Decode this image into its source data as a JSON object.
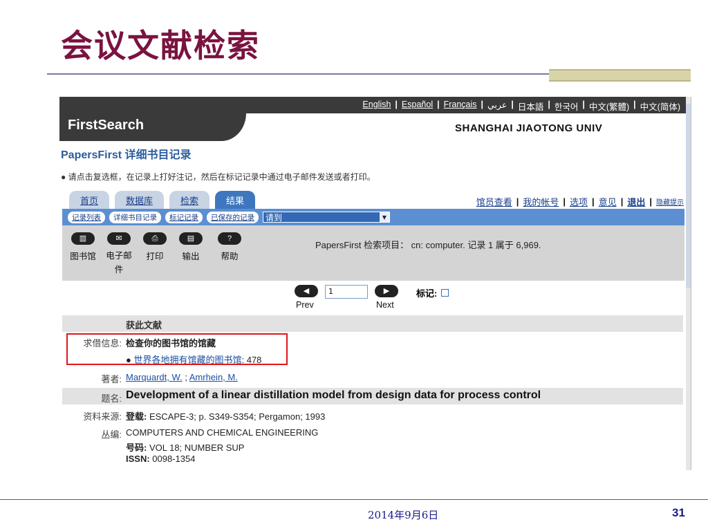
{
  "slide": {
    "title": "会议文献检索",
    "date": "2014年9月6日",
    "page": "31"
  },
  "lang_links": [
    "English",
    "Español",
    "Français",
    "عربي",
    "日本語",
    "한국어",
    "中文(繁體)",
    "中文(简体)"
  ],
  "header": {
    "logo": "FirstSearch",
    "institution": "SHANGHAI JIAOTONG UNIV"
  },
  "record_title": "PapersFirst 详细书目记录",
  "hint": "● 请点击复选框，在记录上打好注记，然后在标记记录中通过电子邮件发送或者打印。",
  "tabs": [
    "首页",
    "数据库",
    "检索",
    "结果"
  ],
  "account_links": {
    "view": "馆员查看",
    "account": "我的帐号",
    "options": "选项",
    "comment": "意见",
    "exit": "退出",
    "hide": "隐藏提示"
  },
  "subnav": {
    "list": "记录列表",
    "detail": "详细书目记录",
    "marked": "标记记录",
    "saved": "已保存的记录",
    "goto": "请到"
  },
  "tools": [
    {
      "label": "图书馆",
      "icon": "library-icon"
    },
    {
      "label": "电子邮件",
      "icon": "email-icon"
    },
    {
      "label": "打印",
      "icon": "print-icon"
    },
    {
      "label": "输出",
      "icon": "export-icon"
    },
    {
      "label": "帮助",
      "icon": "help-icon"
    }
  ],
  "search_info": "PapersFirst 检索项目： cn: computer. 记录 1 属于 6,969.",
  "pager": {
    "page": "1",
    "prev": "Prev",
    "next": "Next",
    "mark_label": "标记:"
  },
  "record": {
    "get_doc": "获此文献",
    "borrow_label": "求借信息:",
    "borrow_value": "检查你的图书馆的馆藏",
    "holdings_link": "世界各地拥有馆藏的图书馆",
    "holdings_count": ": 478",
    "author_label": "著者:",
    "authors": [
      "Marquardt, W.",
      "Amrhein, M."
    ],
    "title_label": "题名:",
    "title": "Development of a linear distillation model from design data for process control",
    "source_label": "资料来源:",
    "source_bold": "登载:",
    "source": " ESCAPE-3; p. S349-S354; Pergamon; 1993",
    "series_label": "丛编:",
    "series": "COMPUTERS AND CHEMICAL ENGINEERING",
    "issue_bold": "号码:",
    "issue": " VOL 18; NUMBER SUP",
    "issn_bold": "ISSN:",
    "issn": " 0098-1354"
  }
}
